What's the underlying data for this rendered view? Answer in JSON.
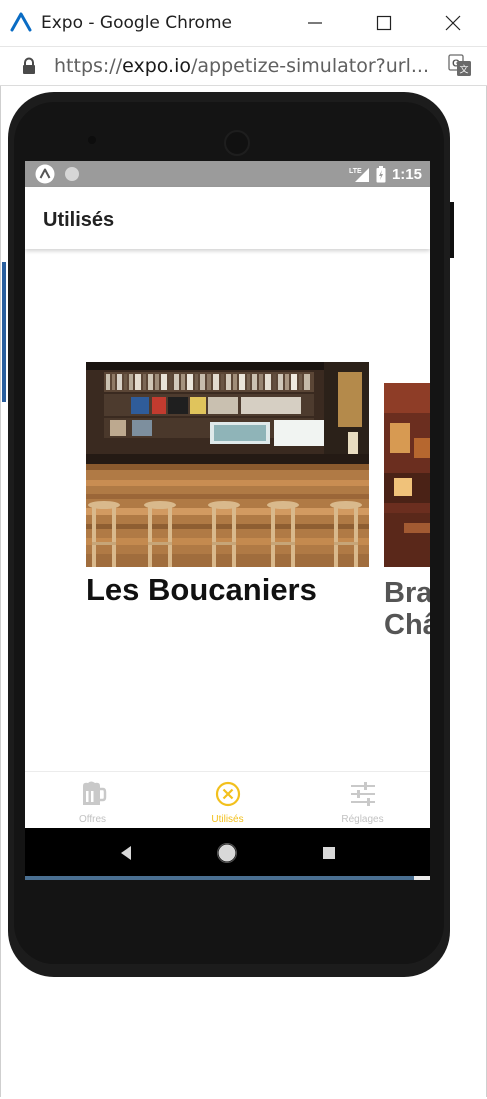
{
  "window": {
    "title": "Expo - Google Chrome",
    "controls": [
      "minimize",
      "maximize",
      "close"
    ]
  },
  "address_bar": {
    "scheme": "https://",
    "host": "expo.io",
    "path": "/appetize-simulator?url..."
  },
  "device": {
    "status_bar": {
      "time": "1:15",
      "network": "LTE"
    },
    "app_bar": {
      "title": "Utilisés"
    },
    "cards": [
      {
        "title": "Les Boucaniers"
      },
      {
        "title": "Bra\nChâ"
      }
    ],
    "tabs": [
      {
        "label": "Offres",
        "icon": "beer-mug-icon",
        "active": false
      },
      {
        "label": "Utilisés",
        "icon": "circle-x-icon",
        "active": true
      },
      {
        "label": "Réglages",
        "icon": "sliders-icon",
        "active": false
      }
    ]
  },
  "colors": {
    "accent": "#f2c01d",
    "status_bar": "#9b9b9b",
    "inactive_tab": "#c2c2c2",
    "phone_body": "#1c1c1c"
  }
}
